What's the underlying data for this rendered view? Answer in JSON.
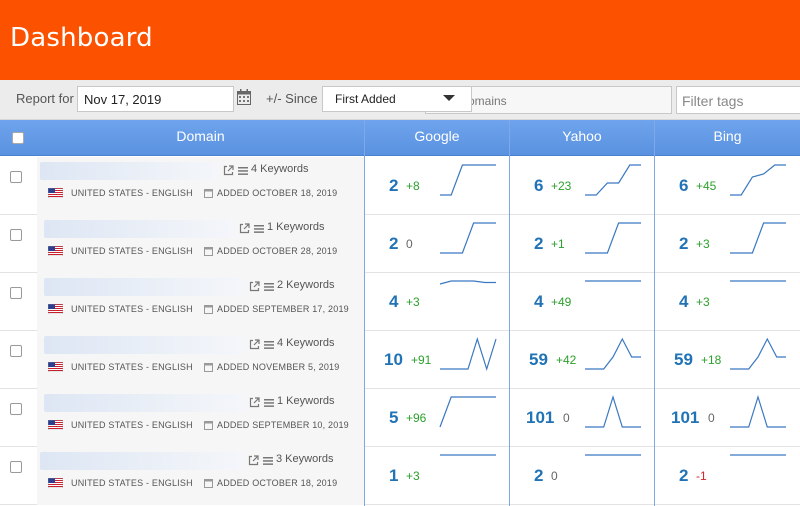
{
  "header": {
    "title": "Dashboard"
  },
  "toolbar": {
    "report_for_label": "Report for",
    "date_value": "Nov 17, 2019",
    "since_label": "+/- Since",
    "since_value": "First Added",
    "domains_placeholder": "omains",
    "tags_placeholder": "Filter tags"
  },
  "table": {
    "columns": [
      "Domain",
      "Google",
      "Yahoo",
      "Bing"
    ]
  },
  "rows": [
    {
      "keywords": "4 Keywords",
      "locale": "UNITED STATES - ENGLISH",
      "added": "ADDED OCTOBER 18, 2019",
      "google": {
        "rank": "2",
        "change": "+8",
        "spark": [
          1,
          1,
          0,
          0,
          0,
          0
        ]
      },
      "yahoo": {
        "rank": "6",
        "change": "+23",
        "spark": [
          1,
          1,
          0.6,
          0.6,
          0,
          0
        ]
      },
      "bing": {
        "rank": "6",
        "change": "+45",
        "spark": [
          1,
          1,
          0.4,
          0.3,
          0,
          0
        ]
      }
    },
    {
      "keywords": "1 Keywords",
      "locale": "UNITED STATES - ENGLISH",
      "added": "ADDED OCTOBER 28, 2019",
      "google": {
        "rank": "2",
        "change": "0",
        "spark": [
          1,
          1,
          1,
          0,
          0,
          0
        ]
      },
      "yahoo": {
        "rank": "2",
        "change": "+1",
        "spark": [
          1,
          1,
          1,
          0,
          0,
          0
        ]
      },
      "bing": {
        "rank": "2",
        "change": "+3",
        "spark": [
          1,
          1,
          1,
          0,
          0,
          0
        ]
      }
    },
    {
      "keywords": "2 Keywords",
      "locale": "UNITED STATES - ENGLISH",
      "added": "ADDED SEPTEMBER 17, 2019",
      "google": {
        "rank": "4",
        "change": "+3",
        "spark": [
          0.1,
          0,
          0,
          0,
          0.05,
          0.05
        ]
      },
      "yahoo": {
        "rank": "4",
        "change": "+49",
        "spark": [
          0,
          0,
          0,
          0,
          0,
          0
        ]
      },
      "bing": {
        "rank": "4",
        "change": "+3",
        "spark": [
          0,
          0,
          0,
          0,
          0,
          0
        ]
      }
    },
    {
      "keywords": "4 Keywords",
      "locale": "UNITED STATES - ENGLISH",
      "added": "ADDED NOVEMBER 5, 2019",
      "google": {
        "rank": "10",
        "change": "+91",
        "spark": [
          1,
          1,
          1,
          1,
          0,
          1,
          0
        ]
      },
      "yahoo": {
        "rank": "59",
        "change": "+42",
        "spark": [
          1,
          1,
          1,
          0.6,
          0,
          0.6,
          0.6
        ]
      },
      "bing": {
        "rank": "59",
        "change": "+18",
        "spark": [
          1,
          1,
          1,
          0.6,
          0,
          0.6,
          0.6
        ]
      }
    },
    {
      "keywords": "1 Keywords",
      "locale": "UNITED STATES - ENGLISH",
      "added": "ADDED SEPTEMBER 10, 2019",
      "google": {
        "rank": "5",
        "change": "+96",
        "spark": [
          1,
          0,
          0,
          0,
          0,
          0
        ]
      },
      "yahoo": {
        "rank": "101",
        "change": "0",
        "spark": [
          1,
          1,
          1,
          0,
          1,
          1,
          1
        ]
      },
      "bing": {
        "rank": "101",
        "change": "0",
        "spark": [
          1,
          1,
          1,
          0,
          1,
          1,
          1
        ]
      }
    },
    {
      "keywords": "3 Keywords",
      "locale": "UNITED STATES - ENGLISH",
      "added": "ADDED OCTOBER 18, 2019",
      "google": {
        "rank": "1",
        "change": "+3",
        "spark": [
          0,
          0,
          0,
          0,
          0,
          0
        ]
      },
      "yahoo": {
        "rank": "2",
        "change": "0",
        "spark": [
          0,
          0,
          0,
          0,
          0,
          0
        ]
      },
      "bing": {
        "rank": "2",
        "change": "-1",
        "spark": [
          0,
          0,
          0,
          0,
          0,
          0
        ]
      }
    }
  ],
  "colors": {
    "header_bg": "#fc5200",
    "rank_blue": "#2173b6",
    "positive": "#2ca02c",
    "negative": "#d62728"
  }
}
